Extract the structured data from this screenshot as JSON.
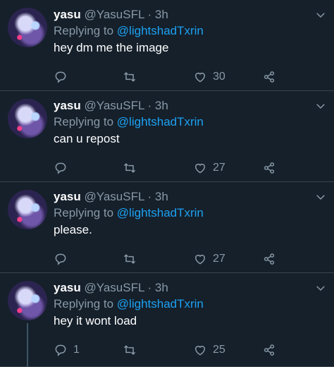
{
  "colors": {
    "background": "#15202b",
    "text": "#ffffff",
    "muted": "#8899a6",
    "link": "#1da1f2",
    "divider": "#38444d"
  },
  "tweets": [
    {
      "name": "yasu",
      "handle": "@YasuSFL",
      "dot": "·",
      "time": "3h",
      "replying_prefix": "Replying to",
      "replying_to": "@lightshadTxrin",
      "text": "hey dm me the image",
      "reply_count": "",
      "like_count": "30"
    },
    {
      "name": "yasu",
      "handle": "@YasuSFL",
      "dot": "·",
      "time": "3h",
      "replying_prefix": "Replying to",
      "replying_to": "@lightshadTxrin",
      "text": "can u repost",
      "reply_count": "",
      "like_count": "27"
    },
    {
      "name": "yasu",
      "handle": "@YasuSFL",
      "dot": "·",
      "time": "3h",
      "replying_prefix": "Replying to",
      "replying_to": "@lightshadTxrin",
      "text": "please.",
      "reply_count": "",
      "like_count": "27"
    },
    {
      "name": "yasu",
      "handle": "@YasuSFL",
      "dot": "·",
      "time": "3h",
      "replying_prefix": "Replying to",
      "replying_to": "@lightshadTxrin",
      "text": "hey it wont load",
      "reply_count": "1",
      "like_count": "25"
    }
  ],
  "icons": {
    "reply": "reply-icon",
    "retweet": "retweet-icon",
    "like": "heart-icon",
    "share": "share-icon",
    "menu": "chevron-down-icon"
  }
}
